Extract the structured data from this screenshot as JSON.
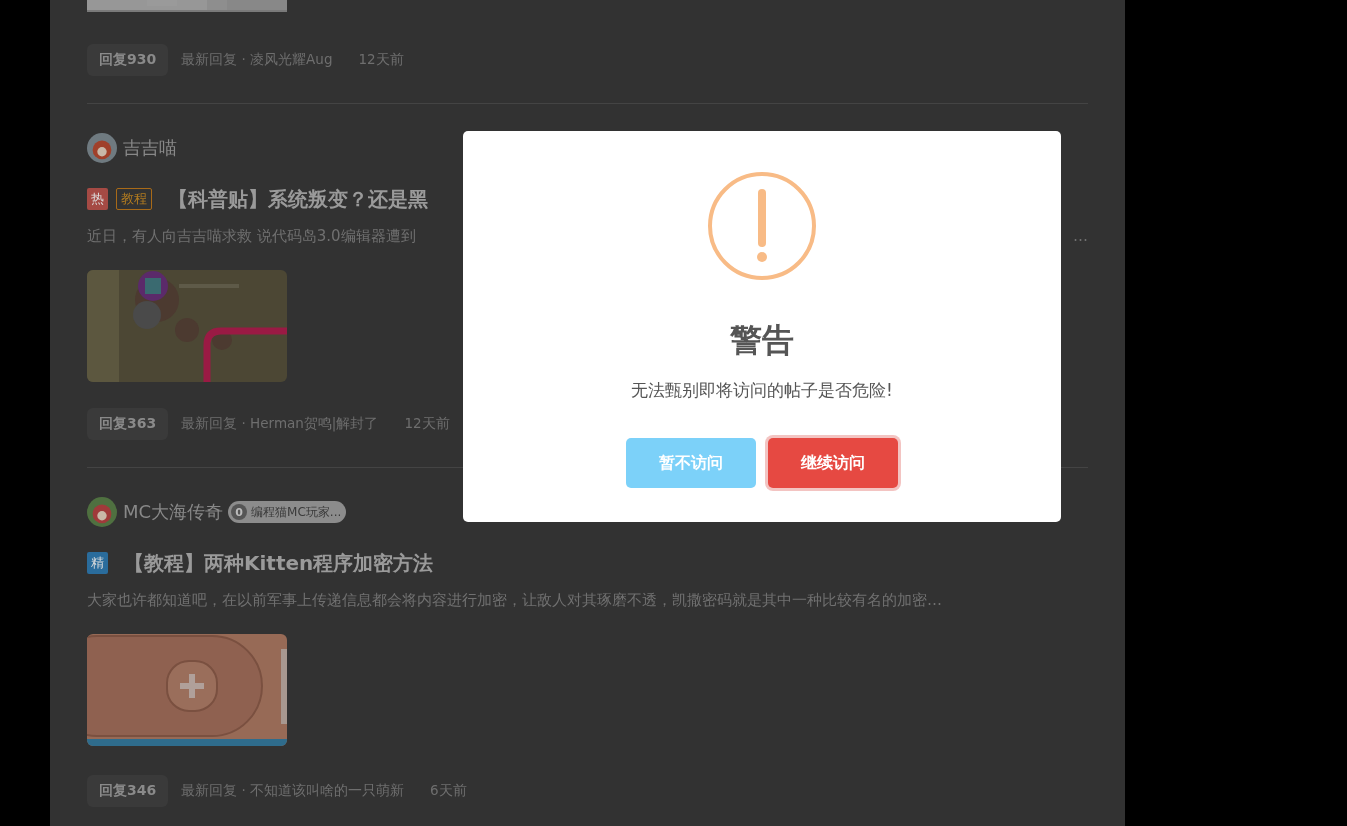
{
  "feed": {
    "top_reply": {
      "count_button": "回复930",
      "latest": "最新回复 · 凌风光耀Aug",
      "time": "12天前"
    },
    "posts": [
      {
        "author": "吉吉喵",
        "tags": [
          {
            "kind": "hot",
            "label": "热"
          },
          {
            "kind": "tutorial",
            "label": "教程"
          }
        ],
        "title": "【科普贴】系统叛变？还是黑",
        "excerpt": "近日，有人向吉吉喵求救 说代码岛3.0编辑器遭到",
        "excerpt_end": "…",
        "reply": {
          "count_button": "回复363",
          "latest": "最新回复 · Herman贺鸣|解封了",
          "time": "12天前"
        }
      },
      {
        "author": "MC大海传奇",
        "badge": {
          "level": "0",
          "text": "编程猫MC玩家..."
        },
        "tags": [
          {
            "kind": "featured",
            "label": "精"
          }
        ],
        "title": "【教程】两种Kitten程序加密方法",
        "excerpt": "大家也许都知道吧，在以前军事上传递信息都会将内容进行加密，让敌人对其琢磨不透，凯撒密码就是其中一种比较有名的加密…",
        "reply": {
          "count_button": "回复346",
          "latest": "最新回复 · 不知道该叫啥的一只萌新",
          "time": "6天前"
        }
      }
    ]
  },
  "dialog": {
    "title": "警告",
    "message": "无法甄别即将访问的帖子是否危险!",
    "buttons": [
      {
        "kind": "cancel",
        "label": "暂不访问"
      },
      {
        "kind": "confirm",
        "label": "继续访问"
      }
    ]
  }
}
